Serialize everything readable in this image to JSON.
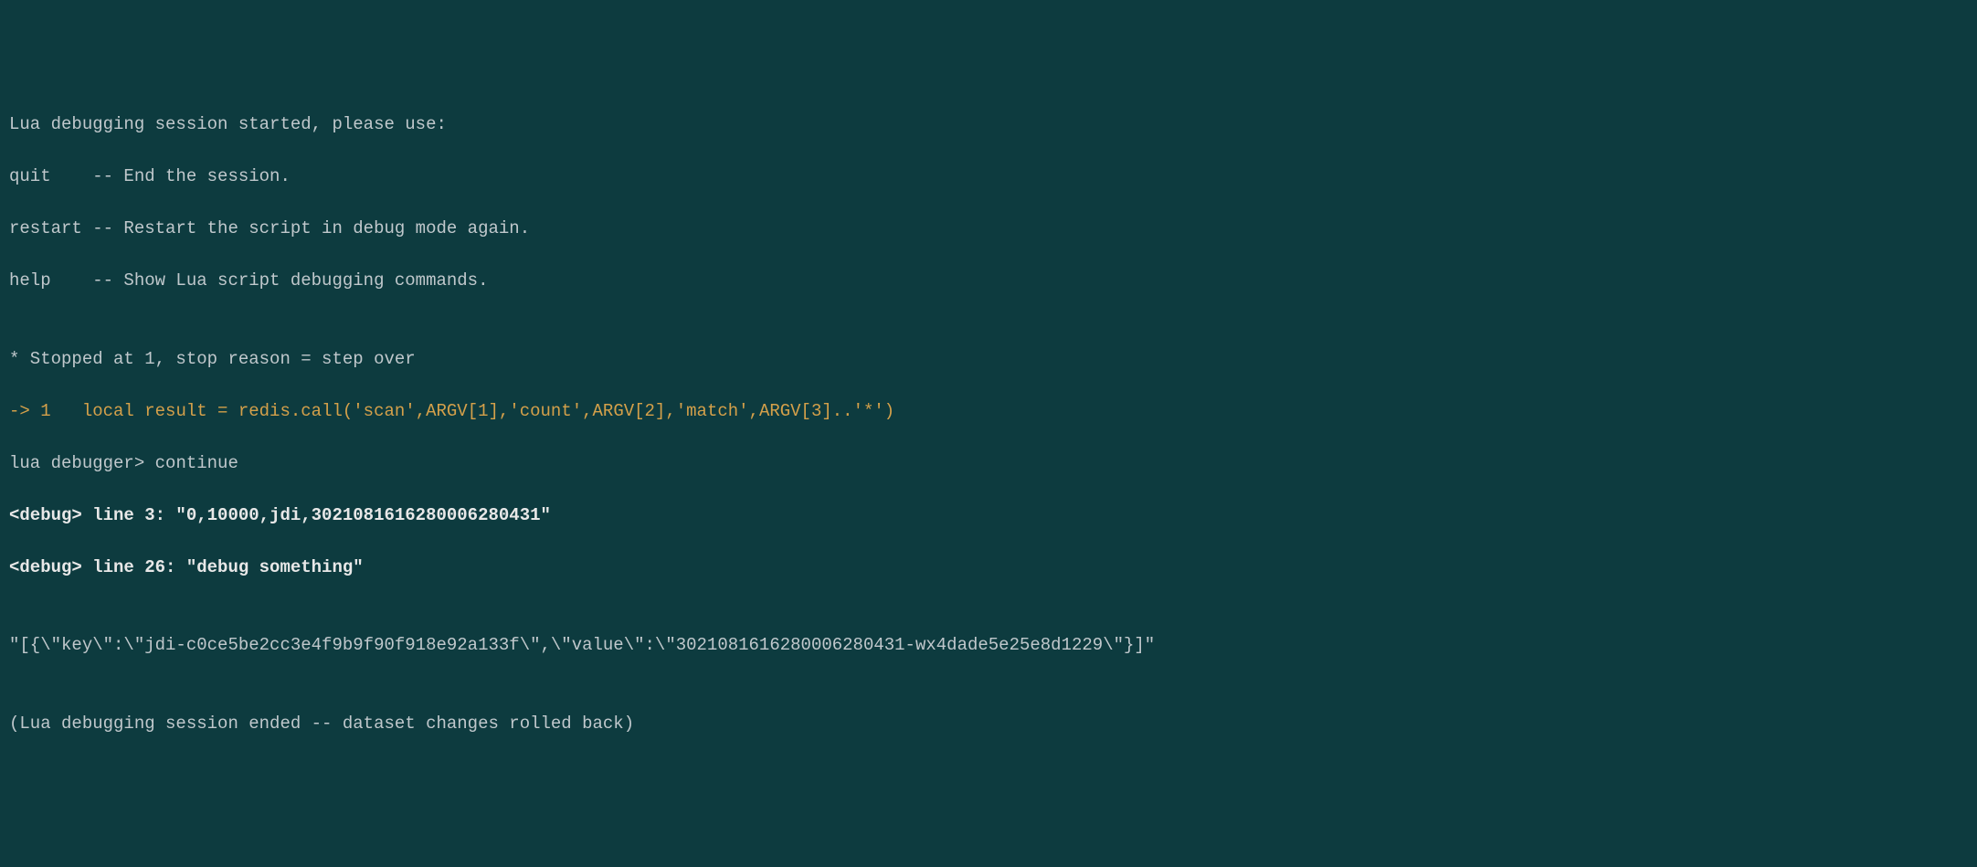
{
  "lines": {
    "header1": "Lua debugging session started, please use:",
    "header2": "quit    -- End the session.",
    "header3": "restart -- Restart the script in debug mode again.",
    "header4": "help    -- Show Lua script debugging commands.",
    "blank1": "",
    "stopped": "* Stopped at 1, stop reason = step over",
    "source_arrow": "-> 1   ",
    "source_code": "local result = redis.call('scan',ARGV[1],'count',ARGV[2],'match',ARGV[3]..'*')",
    "prompt_text": "lua debugger> ",
    "command": "continue",
    "debug1": "<debug> line 3: \"0,10000,jdi,3021081616280006280431\"",
    "debug2": "<debug> line 26: \"debug something\"",
    "blank2": "",
    "result": "\"[{\\\"key\\\":\\\"jdi-c0ce5be2cc3e4f9b9f90f918e92a133f\\\",\\\"value\\\":\\\"3021081616280006280431-wx4dade5e25e8d1229\\\"}]\"",
    "blank3": "",
    "ended": "(Lua debugging session ended -- dataset changes rolled back)"
  }
}
